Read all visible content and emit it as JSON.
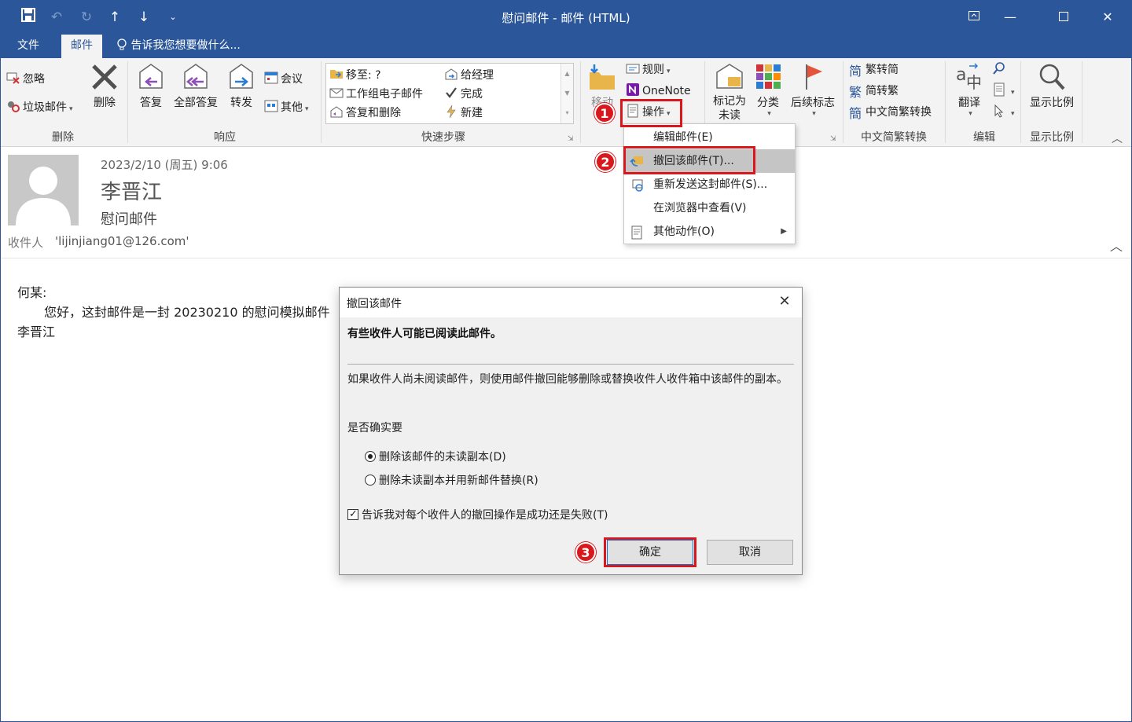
{
  "app": {
    "window_title": "慰问邮件 - 邮件 (HTML)",
    "accent": "#2b579a",
    "highlight": "#d9181d"
  },
  "qat": {
    "save_icon": "save-icon",
    "undo_icon": "undo-icon",
    "redo_icon": "redo-icon",
    "up_icon": "up-arrow-icon",
    "down_icon": "down-arrow-icon",
    "customize_icon": "customize-qat-icon"
  },
  "window_controls": {
    "ribbon_options": "ribbon-display-options-icon",
    "minimize": "minimize-icon",
    "maximize": "maximize-icon",
    "close": "close-icon"
  },
  "tabs": {
    "file": "文件",
    "message": "邮件",
    "tell_me": "告诉我您想要做什么..."
  },
  "ribbon": {
    "delete_group": {
      "label": "删除",
      "ignore": "忽略",
      "junk": "垃圾邮件",
      "delete": "删除"
    },
    "respond_group": {
      "label": "响应",
      "reply": "答复",
      "reply_all": "全部答复",
      "forward": "转发",
      "meeting": "会议",
      "more": "其他"
    },
    "quick_steps_group": {
      "label": "快速步骤",
      "items": [
        "移至: ?",
        "工作组电子邮件",
        "答复和删除",
        "给经理",
        "完成",
        "新建"
      ]
    },
    "move_group": {
      "move": "移动",
      "rules": "规则",
      "onenote": "OneNote",
      "actions": "操作"
    },
    "tags_group": {
      "mark_unread": "标记为未读",
      "categorize": "分类",
      "follow_up": "后续标志"
    },
    "chinese_group": {
      "label": "中文简繁转换",
      "to_simplified": "繁转简",
      "to_traditional": "简转繁",
      "conversion": "中文简繁转换"
    },
    "editing_group": {
      "label": "编辑",
      "translate": "翻译"
    },
    "zoom_group": {
      "label": "显示比例",
      "zoom": "显示比例"
    }
  },
  "message": {
    "date": "2023/2/10 (周五) 9:06",
    "sender": "李晋江",
    "subject": "慰问邮件",
    "to_label": "收件人",
    "to": "'lijinjiang01@126.com'",
    "body": [
      "何某:",
      "您好，这封邮件是一封 20230210 的慰问模拟邮件",
      "李晋江"
    ]
  },
  "actions_menu": {
    "items": [
      "编辑邮件(E)",
      "撤回该邮件(T)...",
      "重新发送这封邮件(S)...",
      "在浏览器中查看(V)",
      "其他动作(O)"
    ],
    "highlighted_index": 1
  },
  "dialog": {
    "title": "撤回该邮件",
    "heading": "有些收件人可能已阅读此邮件。",
    "description": "如果收件人尚未阅读邮件，则使用邮件撤回能够删除或替换收件人收件箱中该邮件的副本。",
    "question": "是否确实要",
    "options": [
      "删除该邮件的未读副本(D)",
      "删除未读副本并用新邮件替换(R)"
    ],
    "selected_option": 0,
    "notify_label": "告诉我对每个收件人的撤回操作是成功还是失败(T)",
    "notify_checked": true,
    "ok": "确定",
    "cancel": "取消"
  },
  "annotations": {
    "step1": "1",
    "step2": "2",
    "step3": "3"
  }
}
